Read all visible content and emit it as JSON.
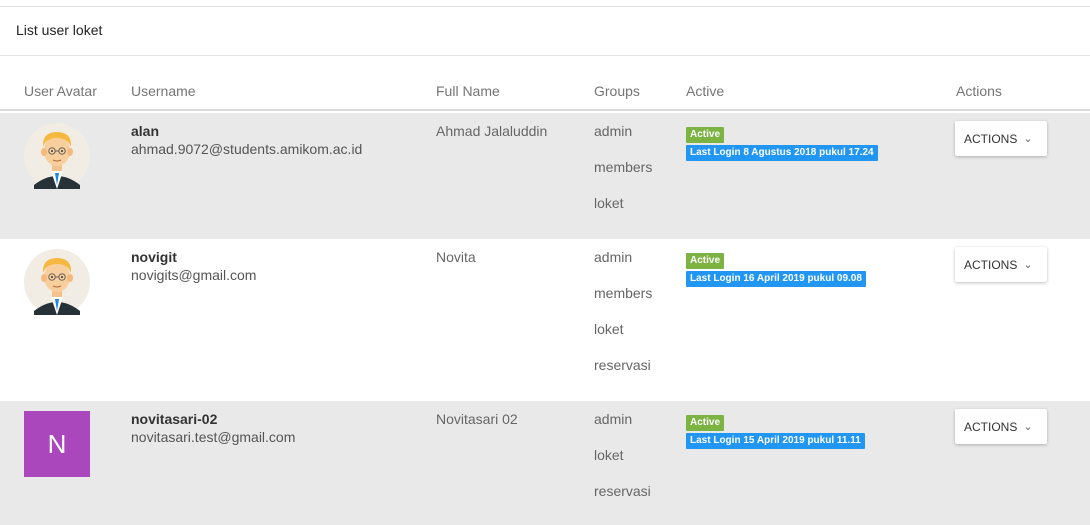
{
  "card": {
    "title": "List user loket"
  },
  "table": {
    "headers": {
      "avatar": "User Avatar",
      "username": "Username",
      "full_name": "Full Name",
      "groups": "Groups",
      "active": "Active",
      "actions": "Actions"
    },
    "rows": [
      {
        "avatar": {
          "type": "image",
          "icon": "businessman-avatar-icon"
        },
        "username": "alan",
        "email": "ahmad.9072@students.amikom.ac.id",
        "full_name": "Ahmad Jalaluddin",
        "groups": [
          "admin",
          "members",
          "loket"
        ],
        "status": "Active",
        "last_login": "Last Login 8 Agustus 2018 pukul 17.24",
        "action_label": "ACTIONS"
      },
      {
        "avatar": {
          "type": "image",
          "icon": "businessman-avatar-icon"
        },
        "username": "novigit",
        "email": "novigits@gmail.com",
        "full_name": "Novita",
        "groups": [
          "admin",
          "members",
          "loket",
          "reservasi"
        ],
        "status": "Active",
        "last_login": "Last Login 16 April 2019 pukul 09.08",
        "action_label": "ACTIONS"
      },
      {
        "avatar": {
          "type": "letter",
          "letter": "N",
          "color": "#ab47bc"
        },
        "username": "novitasari-02",
        "email": "novitasari.test@gmail.com",
        "full_name": "Novitasari 02",
        "groups": [
          "admin",
          "loket",
          "reservasi"
        ],
        "status": "Active",
        "last_login": "Last Login 15 April 2019 pukul 11.11",
        "action_label": "ACTIONS"
      }
    ]
  },
  "colors": {
    "badge_active": "#7cb342",
    "badge_login": "#2196f3",
    "row_shaded": "#e9e9e9"
  }
}
